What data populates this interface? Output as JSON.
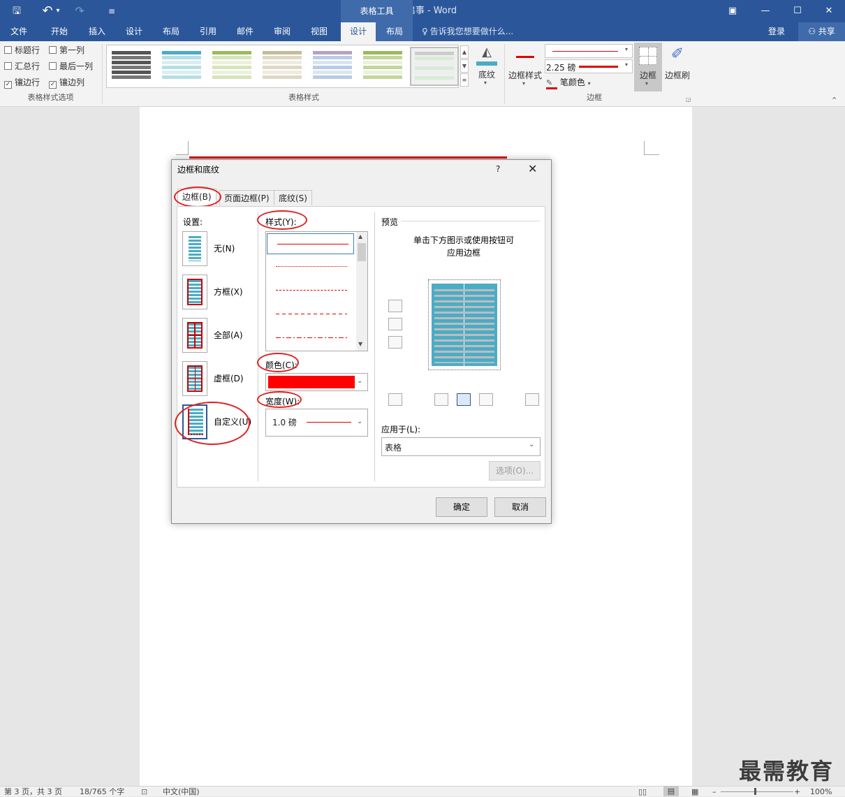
{
  "titlebar": {
    "doc_title": "招聘启事 - Word",
    "context_title": "表格工具",
    "qat": {
      "save": "🖫",
      "undo": "↶",
      "undo_drop": "▾",
      "redo": "↷",
      "customize": "≡"
    },
    "window": {
      "ribbon_opts": "▣",
      "minimize": "—",
      "maximize": "☐",
      "close": "✕"
    }
  },
  "tabs": [
    {
      "label": "文件"
    },
    {
      "label": "开始"
    },
    {
      "label": "插入"
    },
    {
      "label": "设计"
    },
    {
      "label": "布局"
    },
    {
      "label": "引用"
    },
    {
      "label": "邮件"
    },
    {
      "label": "审阅"
    },
    {
      "label": "视图"
    },
    {
      "label": "设计"
    },
    {
      "label": "布局"
    }
  ],
  "tellme": "告诉我您想要做什么...",
  "account": {
    "login": "登录",
    "share": "共享"
  },
  "ribbon": {
    "options": [
      {
        "label": "标题行",
        "checked": false,
        "mark": ""
      },
      {
        "label": "第一列",
        "checked": false,
        "mark": ""
      },
      {
        "label": "汇总行",
        "checked": false,
        "mark": ""
      },
      {
        "label": "最后一列",
        "checked": false,
        "mark": ""
      },
      {
        "label": "镶边行",
        "checked": true,
        "mark": "✓"
      },
      {
        "label": "镶边列",
        "checked": true,
        "mark": "✓"
      }
    ],
    "group_options_label": "表格样式选项",
    "group_styles_label": "表格样式",
    "group_border_label": "边框",
    "shading_label": "底纹",
    "border_styles_label": "边框样式",
    "pen_weight": "2.25 磅",
    "pen_color_label": "笔颜色",
    "borders_label": "边框",
    "border_painter_label": "边框刷",
    "accent_red": "#e00000"
  },
  "dialog": {
    "title": "边框和底纹",
    "help": "?",
    "close": "✕",
    "tabs": [
      "边框(B)",
      "页面边框(P)",
      "底纹(S)"
    ],
    "setting_label": "设置:",
    "settings": [
      "无(N)",
      "方框(X)",
      "全部(A)",
      "虚框(D)",
      "自定义(U)"
    ],
    "style_label": "样式(Y):",
    "color_label": "颜色(C):",
    "color_value": "#ff0000",
    "width_label": "宽度(W):",
    "width_value": "1.0 磅",
    "preview_label": "预览",
    "preview_hint_1": "单击下方图示或使用按钮可",
    "preview_hint_2": "应用边框",
    "apply_to_label": "应用于(L):",
    "apply_to_value": "表格",
    "options_button": "选项(O)...",
    "ok": "确定",
    "cancel": "取消"
  },
  "status": {
    "page": "第 3 页，共 3 页",
    "words": "18/765 个字",
    "lang": "中文(中国)",
    "zoom": "100%"
  },
  "watermark": "最需教育"
}
